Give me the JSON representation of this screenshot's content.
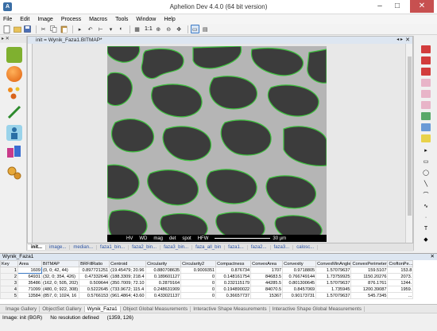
{
  "window": {
    "title": "Aphelion Dev 4.4.0 (64 bit version)",
    "minimize": "–",
    "maximize": "□",
    "close": "✕"
  },
  "menu": [
    "File",
    "Edit",
    "Image",
    "Process",
    "Macros",
    "Tools",
    "Window",
    "Help"
  ],
  "toolbar": {
    "zoom_label": "1:1"
  },
  "left_panel": {
    "title": "✕"
  },
  "document": {
    "title": "init = Wynik_Faza1.BITMAP*",
    "scalebar": {
      "items": [
        "HV",
        "WD",
        "mag",
        "det",
        "spot",
        "HFW"
      ],
      "scale": "30 µm"
    },
    "tabs": [
      "init...",
      "image...",
      "median...",
      "faza1_bin...",
      "faza2_bin...",
      "faza3_bin...",
      "faza_all_bin",
      "faza1...",
      "faza2...",
      "faza3...",
      "calosc..."
    ]
  },
  "table": {
    "title": "Wynik_Faza1",
    "columns": [
      "Key",
      "Area",
      "BITMAP",
      "BRFillRatio",
      "Centroid",
      "Circularity",
      "Circularity2",
      "Compactness",
      "ConvexArea",
      "Convexity",
      "ConvexMinAngle",
      "ConvexPerimeter",
      "CroftonPe..."
    ],
    "rows": [
      [
        "1",
        "1609",
        "(0, 0; 42, 44)",
        "0.897721251",
        "(19.45479; 20.96",
        "0.880708635",
        "0.9009351",
        "0.876734",
        "1707",
        "0.9718805",
        "1.57079637",
        "159.5107",
        "153.8"
      ],
      [
        "2",
        "64931",
        "(32, 0; 354, 426)",
        "0.47332646",
        "(188.3309; 218.4",
        "0.189601127",
        "0",
        "0.148161754",
        "84683.5",
        "0.766749144",
        "1.73759925",
        "1150.20276",
        "2073."
      ],
      [
        "3",
        "35486",
        "(162, 0; 505, 202)",
        "0.509644",
        "(350.7009; 72.10",
        "0.2879164",
        "0",
        "0.232115179",
        "44285.5",
        "0.801300645",
        "1.57079637",
        "876.1761",
        "1244."
      ],
      [
        "4",
        "71099",
        "(480, 0; 922, 308)",
        "0.5222645",
        "(733.9672; 115.4",
        "0.248631909",
        "0",
        "0.194890022",
        "84070.5",
        "0.8457069",
        "1.735945",
        "1200.39087",
        "1959."
      ],
      [
        "5",
        "13584",
        "(857, 0; 1024, 16",
        "0.5766153",
        "(961.4864; 43.60",
        "0.433021137",
        "0",
        "0.36657737",
        "15367",
        "0.90173731",
        "1.57079637",
        "545.7345",
        "..."
      ]
    ]
  },
  "bottom_tabs": [
    "Image Gallery",
    "ObjectSet Gallery",
    "Wynik_Faza1",
    "Object Global Measurements",
    "Interactive Shape Measurements",
    "Interactive Shape Global Measurements"
  ],
  "status": {
    "image": "Image: init (BGR)",
    "resolution": "No resolution defined",
    "coords": "(1359, 126)"
  },
  "colors": {
    "accent": "#3a78c3",
    "phase_outline": "#3ec23e",
    "dark_phase": "#3c3c3c"
  }
}
